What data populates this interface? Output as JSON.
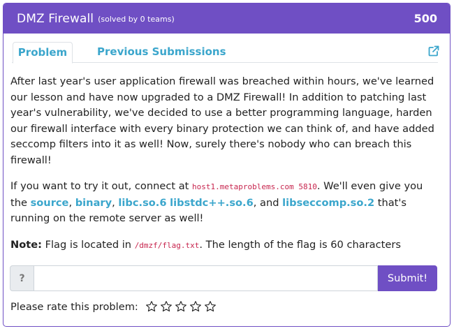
{
  "header": {
    "title": "DMZ Firewall",
    "solved": "(solved by 0 teams)",
    "points": "500",
    "bg_color": "#6f4fc4"
  },
  "tabs": [
    {
      "label": "Problem",
      "active": true
    },
    {
      "label": "Previous Submissions",
      "active": false
    }
  ],
  "external_icon": "external-link-icon",
  "description": {
    "p1": "After last year's user application firewall was breached within hours, we've learned our lesson and have now upgraded to a DMZ Firewall! In addition to patching last year's vulnerability, we've decided to use a better programming language, harden our firewall interface with every binary protection we can think of, and have added seccomp filters into it as well! Now, surely there's nobody who can breach this firewall!",
    "p2_prefix": "If you want to try it out, connect at ",
    "host": "host1.metaproblems.com 5810",
    "p2_mid": ". We'll even give you the ",
    "link_source": "source",
    "comma1": ", ",
    "link_binary": "binary",
    "comma2": ", ",
    "link_libc": "libc.so.6",
    "space": " ",
    "link_libstdc": "libstdc++.so.6",
    "and": ", and ",
    "link_libseccomp": "libseccomp.so.2",
    "p2_suffix": " that's running on the remote server as well!",
    "note_label": "Note:",
    "note_prefix": " Flag is located in ",
    "note_path": "/dmzf/flag.txt",
    "note_suffix": ". The length of the flag is 60 characters"
  },
  "form": {
    "addon": "?",
    "input_value": "",
    "input_placeholder": "",
    "submit_label": "Submit!"
  },
  "rating": {
    "label": "Please rate this problem:",
    "stars": 5,
    "selected": 0,
    "icon": "star-outline-icon"
  }
}
